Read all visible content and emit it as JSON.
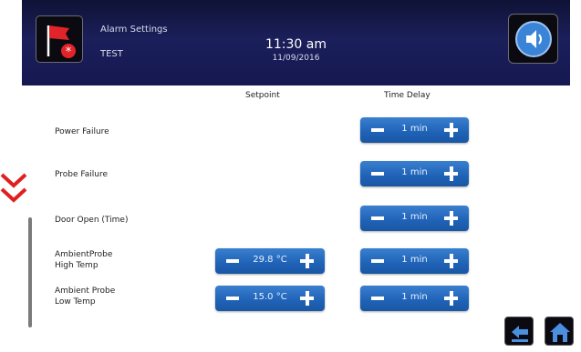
{
  "header": {
    "title": "Alarm Settings",
    "subtitle": "TEST",
    "time": "11:30 am",
    "date": "11/09/2016"
  },
  "columns": {
    "setpoint": "Setpoint",
    "time_delay": "Time Delay"
  },
  "rows": [
    {
      "label_line1": "Power Failure",
      "label_line2": "",
      "setpoint": null,
      "delay": "1 min"
    },
    {
      "label_line1": "Probe Failure",
      "label_line2": "",
      "setpoint": null,
      "delay": "1 min"
    },
    {
      "label_line1": "Door Open (Time)",
      "label_line2": "",
      "setpoint": null,
      "delay": "1 min"
    },
    {
      "label_line1": "AmbientProbe",
      "label_line2": "High Temp",
      "setpoint": "29.8 °C",
      "delay": "1 min"
    },
    {
      "label_line1": "Ambient Probe",
      "label_line2": "Low Temp",
      "setpoint": "15.0 °C",
      "delay": "1 min"
    }
  ],
  "icons": {
    "alarm": "alarm-flag-icon",
    "sound": "speaker-icon",
    "back": "back-arrow-icon",
    "home": "home-icon",
    "scroll_hint": "double-chevron-down-icon"
  },
  "colors": {
    "header_bg": "#1b1f5a",
    "button_blue": "#1f62b6",
    "flag_red": "#e0242a",
    "chevron_red": "#e02020"
  }
}
